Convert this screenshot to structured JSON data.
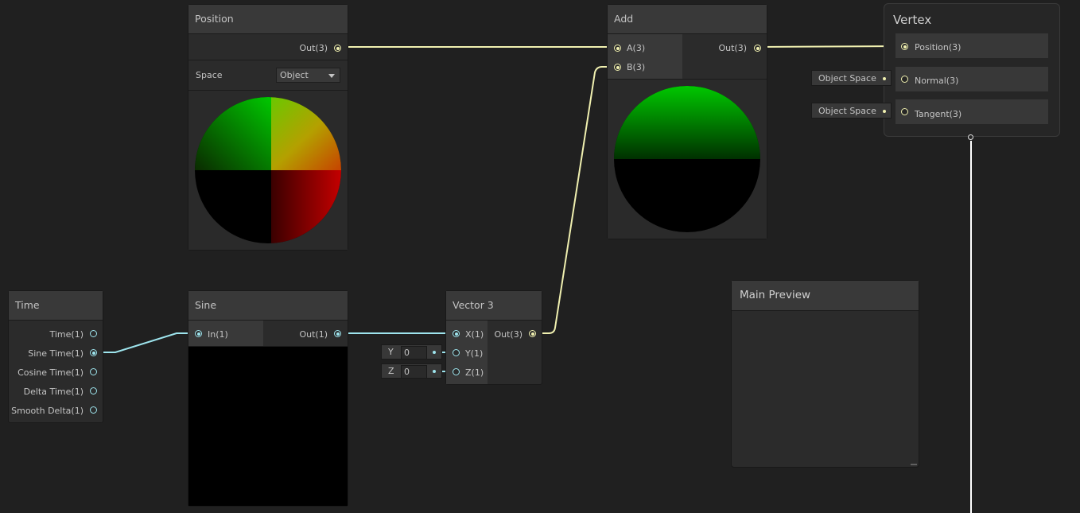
{
  "colors": {
    "vector3_wire": "#f0f0b0",
    "vector1_wire": "#9ee5ee",
    "background": "#202020"
  },
  "nodes": {
    "position": {
      "title": "Position",
      "out": "Out(3)",
      "space_label": "Space",
      "space_value": "Object"
    },
    "add": {
      "title": "Add",
      "in_a": "A(3)",
      "in_b": "B(3)",
      "out": "Out(3)"
    },
    "vertex": {
      "title": "Vertex",
      "ports": [
        "Position(3)",
        "Normal(3)",
        "Tangent(3)"
      ],
      "normal_space": "Object Space",
      "tangent_space": "Object Space"
    },
    "time": {
      "title": "Time",
      "outputs": [
        "Time(1)",
        "Sine Time(1)",
        "Cosine Time(1)",
        "Delta Time(1)",
        "Smooth Delta(1)"
      ]
    },
    "sine": {
      "title": "Sine",
      "in": "In(1)",
      "out": "Out(1)"
    },
    "vector3": {
      "title": "Vector 3",
      "x": "X(1)",
      "y": "Y(1)",
      "z": "Z(1)",
      "out": "Out(3)",
      "y_label": "Y",
      "y_value": "0",
      "z_label": "Z",
      "z_value": "0"
    }
  },
  "main_preview": {
    "title": "Main Preview"
  }
}
